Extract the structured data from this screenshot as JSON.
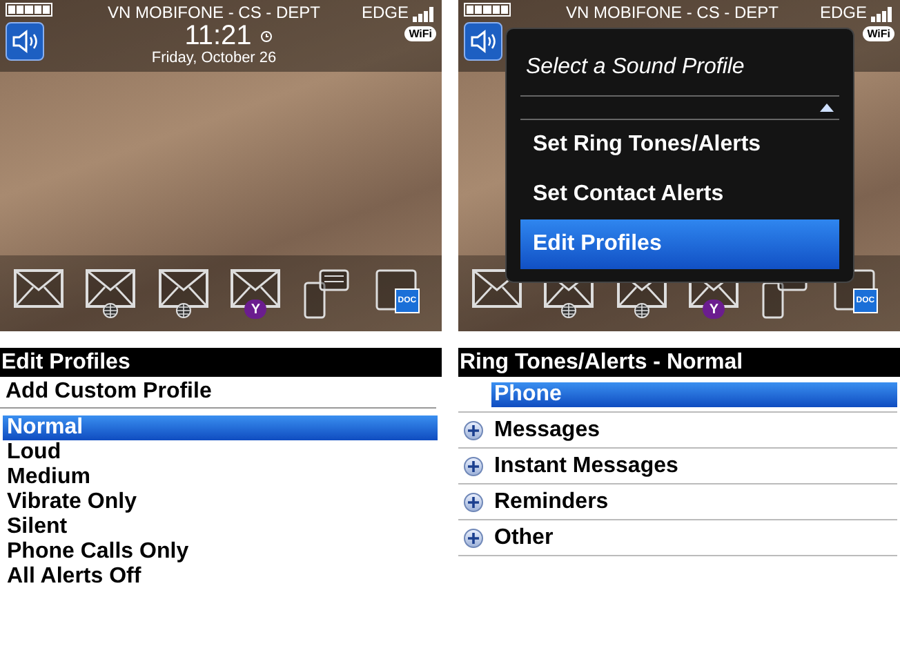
{
  "home_screen": {
    "status_bar": {
      "carrier": "VN MOBIFONE - CS - DEPT",
      "network": "EDGE",
      "wifi": "WiFi"
    },
    "time": "11:21",
    "date": "Friday, October 26",
    "dock": [
      {
        "kind": "mail"
      },
      {
        "kind": "mail-web"
      },
      {
        "kind": "mail-web"
      },
      {
        "kind": "mail-yahoo",
        "badge": "Y"
      },
      {
        "kind": "chat"
      },
      {
        "kind": "doc",
        "badge": "DOC"
      }
    ]
  },
  "profile_menu_screen": {
    "status_bar": {
      "carrier": "VN MOBIFONE - CS - DEPT",
      "network": "EDGE",
      "wifi": "WiFi"
    },
    "dock": [
      {
        "kind": "mail"
      },
      {
        "kind": "mail-web"
      },
      {
        "kind": "mail-web"
      },
      {
        "kind": "mail-yahoo",
        "badge": "Y"
      },
      {
        "kind": "chat"
      },
      {
        "kind": "doc",
        "badge": "DOC"
      }
    ],
    "dialog": {
      "title": "Select a Sound Profile",
      "items": [
        {
          "label": "Set Ring Tones/Alerts",
          "selected": false
        },
        {
          "label": "Set Contact Alerts",
          "selected": false
        },
        {
          "label": "Edit Profiles",
          "selected": true
        }
      ]
    }
  },
  "edit_profiles_screen": {
    "title": "Edit Profiles",
    "action": "Add Custom Profile",
    "profiles": [
      {
        "label": "Normal",
        "selected": true
      },
      {
        "label": "Loud",
        "selected": false
      },
      {
        "label": "Medium",
        "selected": false
      },
      {
        "label": "Vibrate Only",
        "selected": false
      },
      {
        "label": "Silent",
        "selected": false
      },
      {
        "label": "Phone Calls Only",
        "selected": false
      },
      {
        "label": "All Alerts Off",
        "selected": false
      }
    ]
  },
  "ring_tones_screen": {
    "title": "Ring Tones/Alerts - Normal",
    "categories": [
      {
        "label": "Phone",
        "kind": "leaf",
        "selected": true
      },
      {
        "label": "Messages",
        "kind": "group",
        "selected": false
      },
      {
        "label": "Instant Messages",
        "kind": "group",
        "selected": false
      },
      {
        "label": "Reminders",
        "kind": "group",
        "selected": false
      },
      {
        "label": "Other",
        "kind": "group",
        "selected": false
      }
    ]
  }
}
